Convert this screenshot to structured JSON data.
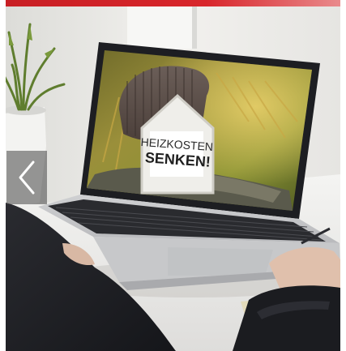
{
  "colors": {
    "accent_red": "#d8262b",
    "overlay": "#4a4a4a"
  },
  "slide": {
    "sign_line1": "HEIZKOSTEN",
    "sign_line2": "SENKEN!"
  },
  "carousel": {
    "prev_icon": "chevron-left-icon"
  }
}
